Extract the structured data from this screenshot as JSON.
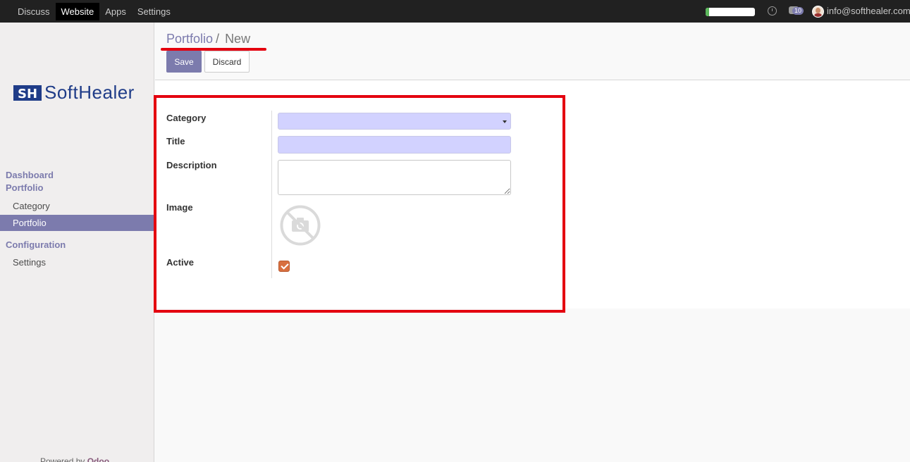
{
  "topbar": {
    "menu": [
      {
        "label": "Discuss",
        "active": false
      },
      {
        "label": "Website",
        "active": true
      },
      {
        "label": "Apps",
        "active": false
      },
      {
        "label": "Settings",
        "active": false
      }
    ],
    "progress_fraction": 0.07,
    "chat_badge": "10",
    "user_email": "info@softhealer.com"
  },
  "sidebar": {
    "logo": {
      "mark": "SH",
      "word": "SoftHealer"
    },
    "groups": [
      {
        "label": "Dashboard"
      },
      {
        "label": "Portfolio"
      },
      {
        "label": "Configuration"
      }
    ],
    "items": [
      {
        "label": "Category",
        "active": false
      },
      {
        "label": "Portfolio",
        "active": true
      },
      {
        "label": "Settings",
        "active": false
      }
    ],
    "powered_by": {
      "prefix": "Powered by",
      "brand": "Odoo"
    }
  },
  "control": {
    "breadcrumb": {
      "parent": "Portfolio",
      "separator": "/",
      "current": "New"
    },
    "save_label": "Save",
    "discard_label": "Discard"
  },
  "form": {
    "category_label": "Category",
    "category_value": "",
    "title_label": "Title",
    "title_value": "",
    "description_label": "Description",
    "description_value": "",
    "image_label": "Image",
    "image_icon": "camera-off-icon",
    "active_label": "Active",
    "active_checked": true
  },
  "colors": {
    "brand": "#7c7bad",
    "highlight": "#e4000f",
    "required_field": "#d2d2ff",
    "checkbox": "#d86f3f"
  }
}
